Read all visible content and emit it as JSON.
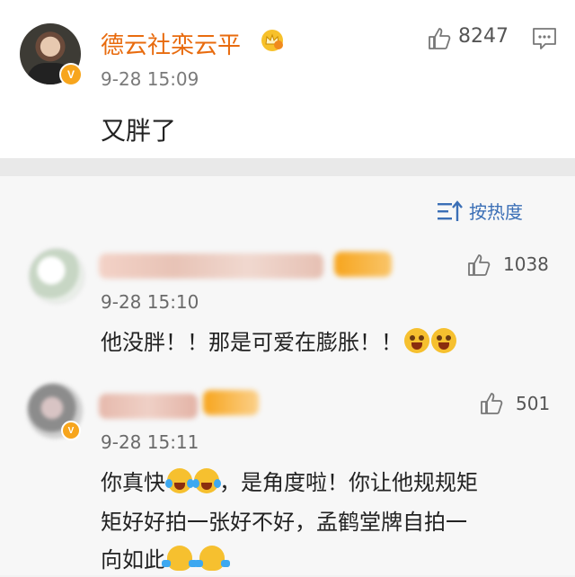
{
  "post": {
    "author_name": "德云社栾云平",
    "verified_badge_text": "V",
    "timestamp": "9-28 15:09",
    "text": "又胖了",
    "like_count": "8247",
    "icons": {
      "like": "thumbs-up-icon",
      "comment": "comment-icon",
      "crown": "crown-icon"
    }
  },
  "sort": {
    "label": "按热度",
    "icon": "sort-icon"
  },
  "replies": [
    {
      "timestamp": "9-28 15:10",
      "text": "他没胖！！那是可爱在膨胀！！",
      "like_count": "1038",
      "emojis": [
        "angry-emoji",
        "angry-emoji"
      ]
    },
    {
      "timestamp": "9-28 15:11",
      "verified_badge_text": "V",
      "line1_a": "你真快",
      "line1_b": "，是角度啦！你让他规规矩",
      "line2": "矩好好拍一张好不好，孟鹤堂牌自拍一",
      "line3": "向如此",
      "like_count": "501",
      "emojis": [
        "laugh-cry-emoji",
        "laugh-cry-emoji",
        "shrug-emoji",
        "shrug-emoji"
      ]
    }
  ],
  "colors": {
    "author": "#e86b0e",
    "sort_link": "#3b6fb6",
    "badge": "#f7a51d",
    "text": "#222222",
    "meta": "#7a7a7a"
  }
}
